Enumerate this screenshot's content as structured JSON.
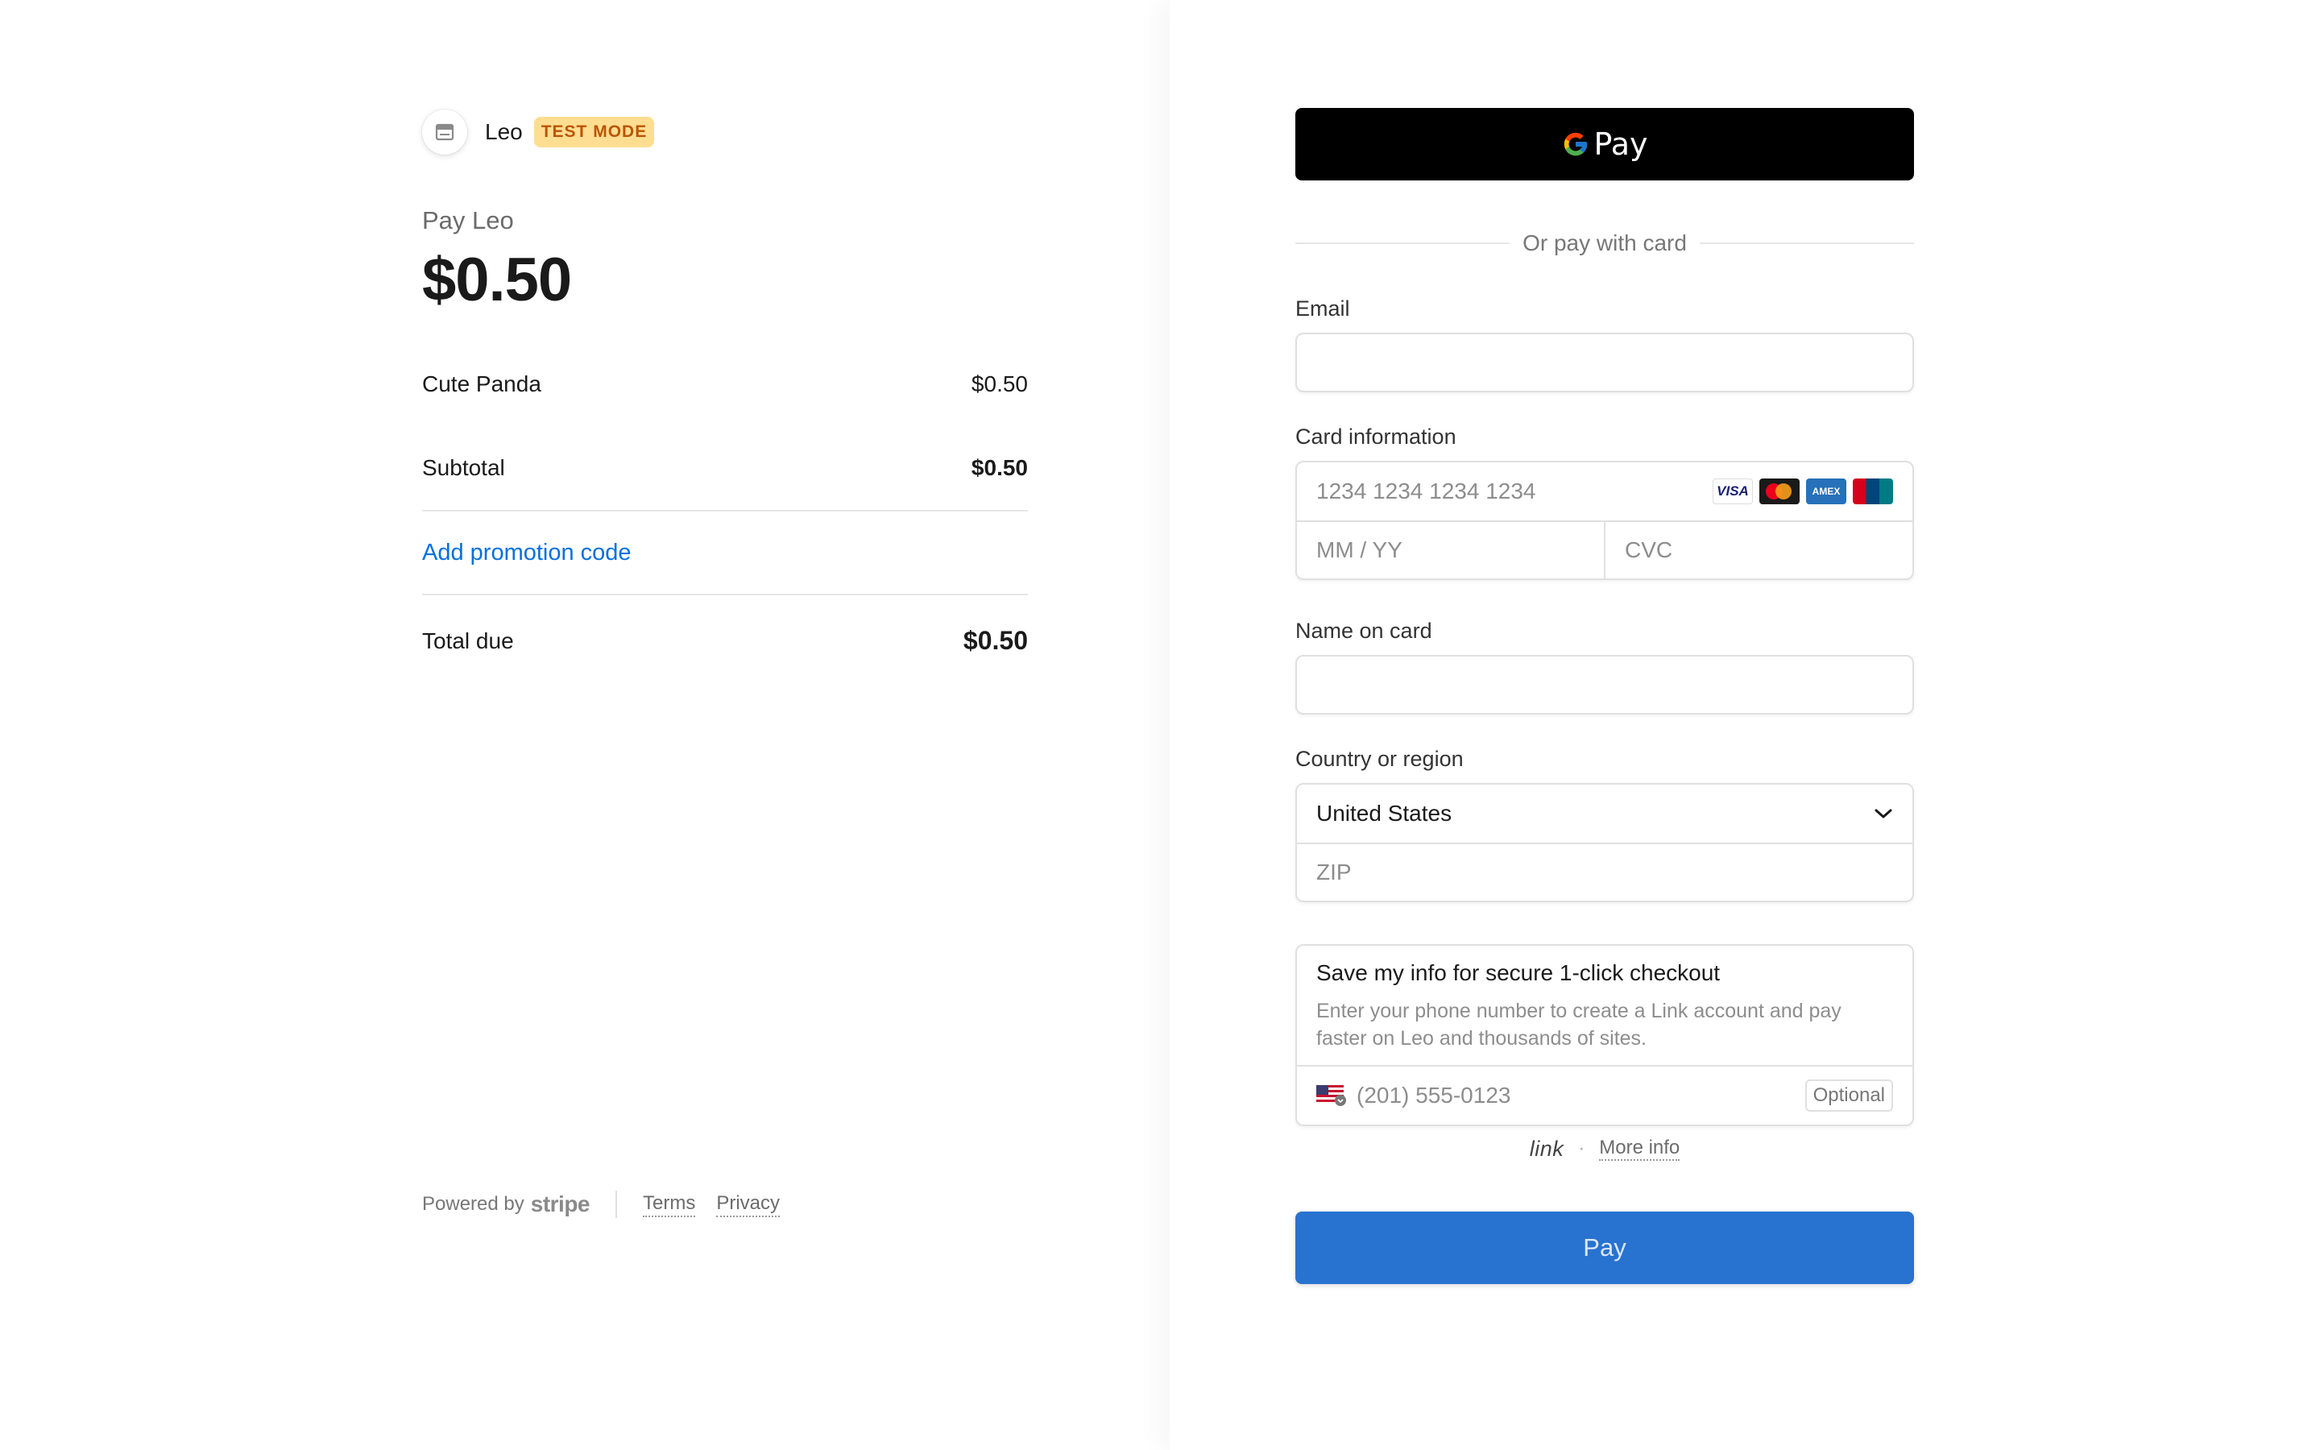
{
  "merchant": {
    "name": "Leo",
    "badge": "TEST MODE",
    "avatar_icon": "store-icon"
  },
  "summary": {
    "pay_label": "Pay Leo",
    "amount": "$0.50",
    "line_items": [
      {
        "name": "Cute Panda",
        "price": "$0.50"
      }
    ],
    "subtotal_label": "Subtotal",
    "subtotal_value": "$0.50",
    "promo_label": "Add promotion code",
    "total_label": "Total due",
    "total_value": "$0.50"
  },
  "footer": {
    "powered_by": "Powered by",
    "brand": "stripe",
    "terms": "Terms",
    "privacy": "Privacy"
  },
  "payment": {
    "gpay_label": "Pay",
    "divider_text": "Or pay with card",
    "email_label": "Email",
    "email_value": "",
    "card_label": "Card information",
    "card_number_placeholder": "1234 1234 1234 1234",
    "expiry_placeholder": "MM / YY",
    "cvc_placeholder": "CVC",
    "card_brands": [
      "VISA",
      "mastercard",
      "AMEX",
      "UnionPay"
    ],
    "name_label": "Name on card",
    "name_value": "",
    "country_label": "Country or region",
    "country_value": "United States",
    "zip_placeholder": "ZIP",
    "link_title": "Save my info for secure 1-click checkout",
    "link_desc": "Enter your phone number to create a Link account and pay faster on Leo and thousands of sites.",
    "phone_placeholder": "(201) 555-0123",
    "optional_label": "Optional",
    "link_logo": "link",
    "more_info": "More info",
    "pay_button": "Pay"
  },
  "colors": {
    "accent": "#0570de",
    "pay_button": "#2872d0",
    "badge_bg": "#ffde92",
    "badge_text": "#bb5504"
  }
}
